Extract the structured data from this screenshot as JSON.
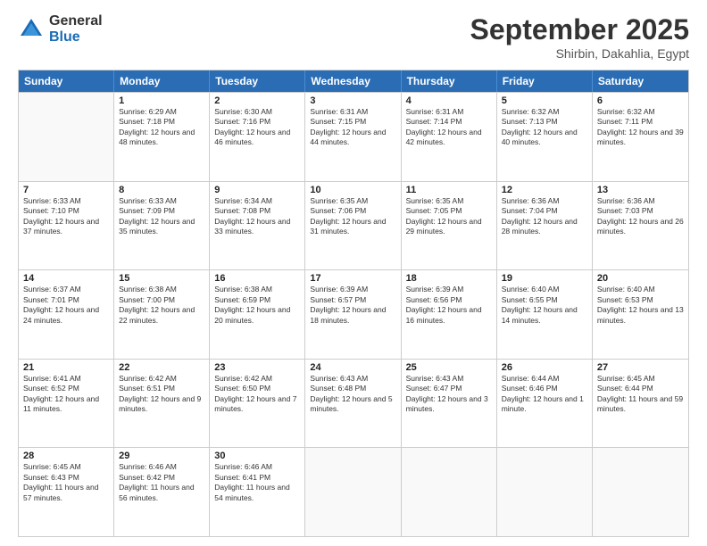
{
  "header": {
    "logo_general": "General",
    "logo_blue": "Blue",
    "month_title": "September 2025",
    "location": "Shirbin, Dakahlia, Egypt"
  },
  "days_of_week": [
    "Sunday",
    "Monday",
    "Tuesday",
    "Wednesday",
    "Thursday",
    "Friday",
    "Saturday"
  ],
  "weeks": [
    [
      {
        "day": "",
        "sunrise": "",
        "sunset": "",
        "daylight": ""
      },
      {
        "day": "1",
        "sunrise": "Sunrise: 6:29 AM",
        "sunset": "Sunset: 7:18 PM",
        "daylight": "Daylight: 12 hours and 48 minutes."
      },
      {
        "day": "2",
        "sunrise": "Sunrise: 6:30 AM",
        "sunset": "Sunset: 7:16 PM",
        "daylight": "Daylight: 12 hours and 46 minutes."
      },
      {
        "day": "3",
        "sunrise": "Sunrise: 6:31 AM",
        "sunset": "Sunset: 7:15 PM",
        "daylight": "Daylight: 12 hours and 44 minutes."
      },
      {
        "day": "4",
        "sunrise": "Sunrise: 6:31 AM",
        "sunset": "Sunset: 7:14 PM",
        "daylight": "Daylight: 12 hours and 42 minutes."
      },
      {
        "day": "5",
        "sunrise": "Sunrise: 6:32 AM",
        "sunset": "Sunset: 7:13 PM",
        "daylight": "Daylight: 12 hours and 40 minutes."
      },
      {
        "day": "6",
        "sunrise": "Sunrise: 6:32 AM",
        "sunset": "Sunset: 7:11 PM",
        "daylight": "Daylight: 12 hours and 39 minutes."
      }
    ],
    [
      {
        "day": "7",
        "sunrise": "Sunrise: 6:33 AM",
        "sunset": "Sunset: 7:10 PM",
        "daylight": "Daylight: 12 hours and 37 minutes."
      },
      {
        "day": "8",
        "sunrise": "Sunrise: 6:33 AM",
        "sunset": "Sunset: 7:09 PM",
        "daylight": "Daylight: 12 hours and 35 minutes."
      },
      {
        "day": "9",
        "sunrise": "Sunrise: 6:34 AM",
        "sunset": "Sunset: 7:08 PM",
        "daylight": "Daylight: 12 hours and 33 minutes."
      },
      {
        "day": "10",
        "sunrise": "Sunrise: 6:35 AM",
        "sunset": "Sunset: 7:06 PM",
        "daylight": "Daylight: 12 hours and 31 minutes."
      },
      {
        "day": "11",
        "sunrise": "Sunrise: 6:35 AM",
        "sunset": "Sunset: 7:05 PM",
        "daylight": "Daylight: 12 hours and 29 minutes."
      },
      {
        "day": "12",
        "sunrise": "Sunrise: 6:36 AM",
        "sunset": "Sunset: 7:04 PM",
        "daylight": "Daylight: 12 hours and 28 minutes."
      },
      {
        "day": "13",
        "sunrise": "Sunrise: 6:36 AM",
        "sunset": "Sunset: 7:03 PM",
        "daylight": "Daylight: 12 hours and 26 minutes."
      }
    ],
    [
      {
        "day": "14",
        "sunrise": "Sunrise: 6:37 AM",
        "sunset": "Sunset: 7:01 PM",
        "daylight": "Daylight: 12 hours and 24 minutes."
      },
      {
        "day": "15",
        "sunrise": "Sunrise: 6:38 AM",
        "sunset": "Sunset: 7:00 PM",
        "daylight": "Daylight: 12 hours and 22 minutes."
      },
      {
        "day": "16",
        "sunrise": "Sunrise: 6:38 AM",
        "sunset": "Sunset: 6:59 PM",
        "daylight": "Daylight: 12 hours and 20 minutes."
      },
      {
        "day": "17",
        "sunrise": "Sunrise: 6:39 AM",
        "sunset": "Sunset: 6:57 PM",
        "daylight": "Daylight: 12 hours and 18 minutes."
      },
      {
        "day": "18",
        "sunrise": "Sunrise: 6:39 AM",
        "sunset": "Sunset: 6:56 PM",
        "daylight": "Daylight: 12 hours and 16 minutes."
      },
      {
        "day": "19",
        "sunrise": "Sunrise: 6:40 AM",
        "sunset": "Sunset: 6:55 PM",
        "daylight": "Daylight: 12 hours and 14 minutes."
      },
      {
        "day": "20",
        "sunrise": "Sunrise: 6:40 AM",
        "sunset": "Sunset: 6:53 PM",
        "daylight": "Daylight: 12 hours and 13 minutes."
      }
    ],
    [
      {
        "day": "21",
        "sunrise": "Sunrise: 6:41 AM",
        "sunset": "Sunset: 6:52 PM",
        "daylight": "Daylight: 12 hours and 11 minutes."
      },
      {
        "day": "22",
        "sunrise": "Sunrise: 6:42 AM",
        "sunset": "Sunset: 6:51 PM",
        "daylight": "Daylight: 12 hours and 9 minutes."
      },
      {
        "day": "23",
        "sunrise": "Sunrise: 6:42 AM",
        "sunset": "Sunset: 6:50 PM",
        "daylight": "Daylight: 12 hours and 7 minutes."
      },
      {
        "day": "24",
        "sunrise": "Sunrise: 6:43 AM",
        "sunset": "Sunset: 6:48 PM",
        "daylight": "Daylight: 12 hours and 5 minutes."
      },
      {
        "day": "25",
        "sunrise": "Sunrise: 6:43 AM",
        "sunset": "Sunset: 6:47 PM",
        "daylight": "Daylight: 12 hours and 3 minutes."
      },
      {
        "day": "26",
        "sunrise": "Sunrise: 6:44 AM",
        "sunset": "Sunset: 6:46 PM",
        "daylight": "Daylight: 12 hours and 1 minute."
      },
      {
        "day": "27",
        "sunrise": "Sunrise: 6:45 AM",
        "sunset": "Sunset: 6:44 PM",
        "daylight": "Daylight: 11 hours and 59 minutes."
      }
    ],
    [
      {
        "day": "28",
        "sunrise": "Sunrise: 6:45 AM",
        "sunset": "Sunset: 6:43 PM",
        "daylight": "Daylight: 11 hours and 57 minutes."
      },
      {
        "day": "29",
        "sunrise": "Sunrise: 6:46 AM",
        "sunset": "Sunset: 6:42 PM",
        "daylight": "Daylight: 11 hours and 56 minutes."
      },
      {
        "day": "30",
        "sunrise": "Sunrise: 6:46 AM",
        "sunset": "Sunset: 6:41 PM",
        "daylight": "Daylight: 11 hours and 54 minutes."
      },
      {
        "day": "",
        "sunrise": "",
        "sunset": "",
        "daylight": ""
      },
      {
        "day": "",
        "sunrise": "",
        "sunset": "",
        "daylight": ""
      },
      {
        "day": "",
        "sunrise": "",
        "sunset": "",
        "daylight": ""
      },
      {
        "day": "",
        "sunrise": "",
        "sunset": "",
        "daylight": ""
      }
    ]
  ]
}
